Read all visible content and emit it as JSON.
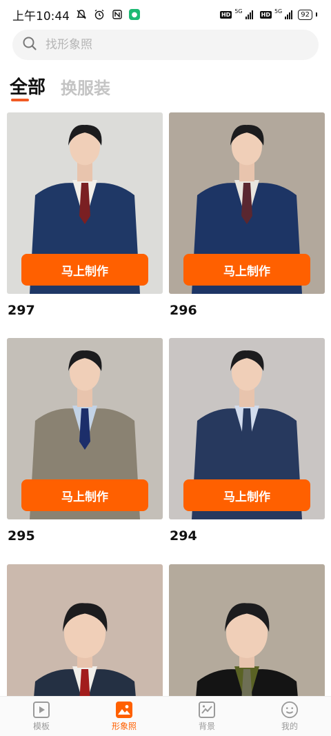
{
  "status_bar": {
    "time": "上午10:44",
    "network_1": "5G",
    "network_2": "5G",
    "hd": "HD",
    "battery": "92"
  },
  "search": {
    "placeholder": "找形象照"
  },
  "tabs": [
    {
      "label": "全部",
      "active": true
    },
    {
      "label": "换服装",
      "active": false
    }
  ],
  "cards": [
    {
      "number": "297",
      "button_label": "马上制作",
      "bg": "#dcdcd9",
      "suit": "#1f3866",
      "shirt": "#f2efe9",
      "tie": "#7a1f22"
    },
    {
      "number": "296",
      "button_label": "马上制作",
      "bg": "#b2a89c",
      "suit": "#1d3565",
      "shirt": "#e9e6df",
      "tie": "#5a2730"
    },
    {
      "number": "295",
      "button_label": "马上制作",
      "bg": "#c4bfb8",
      "suit": "#8a8272",
      "shirt": "#c3d3e6",
      "tie": "#1c2e6a"
    },
    {
      "number": "294",
      "button_label": "马上制作",
      "bg": "#c9c5c3",
      "suit": "#27395e",
      "shirt": "#d2dced",
      "tie": "#27395e"
    },
    {
      "number": "",
      "button_label": "",
      "bg": "#cbb9ad",
      "suit": "#243043",
      "shirt": "#f1efea",
      "tie": "#a21c1c"
    },
    {
      "number": "",
      "button_label": "",
      "bg": "#b4aa9c",
      "suit": "#141414",
      "shirt": "#5a6224",
      "tie": "#6e6f55"
    }
  ],
  "bottom_nav": [
    {
      "label": "模板",
      "icon": "play-template-icon",
      "active": false
    },
    {
      "label": "形象照",
      "icon": "image-photo-icon",
      "active": true
    },
    {
      "label": "背景",
      "icon": "background-chart-icon",
      "active": false
    },
    {
      "label": "我的",
      "icon": "smiley-profile-icon",
      "active": false
    }
  ],
  "colors": {
    "accent": "#ff6000",
    "tab_underline": "#f15a24",
    "inactive": "#9a9a9a"
  }
}
